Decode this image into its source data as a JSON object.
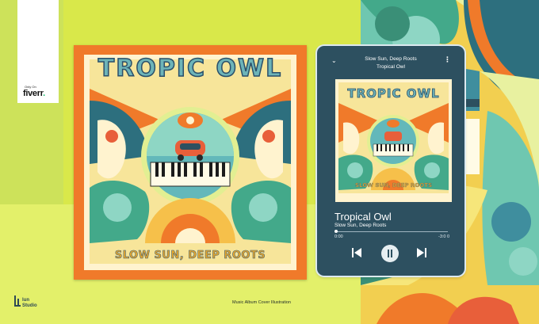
{
  "badge": {
    "only_on": "Only On",
    "brand": "fiverr",
    "dot": "."
  },
  "album": {
    "title": "TROPIC OWL",
    "subtitle": "SLOW SUN, DEEP ROOTS"
  },
  "player": {
    "header_line1": "Slow Sun, Deep Roots",
    "header_line2": "Tropical Owl",
    "art_title": "TROPIC OWL",
    "art_subtitle": "SLOW SUN, DEEP ROOTS",
    "song_title": "Tropical Owl",
    "artist": "Slow Sun, Deep Roots",
    "time_elapsed": "0:00",
    "time_remaining": "-3:0 0",
    "progress": 0.0
  },
  "footer": {
    "brand_line1": "lun",
    "brand_line2": "Studio",
    "caption": "Music Album Cover Illustration"
  },
  "colors": {
    "background": "#d9e84a",
    "phone": "#2d5060",
    "album_border": "#f07a2a",
    "accent_teal": "#6db4b8",
    "fiverr_green": "#1dbf73"
  },
  "icons": [
    "chevron-down-icon",
    "more-vertical-icon",
    "skip-previous-icon",
    "pause-icon",
    "skip-next-icon",
    "lun-logo-icon"
  ]
}
